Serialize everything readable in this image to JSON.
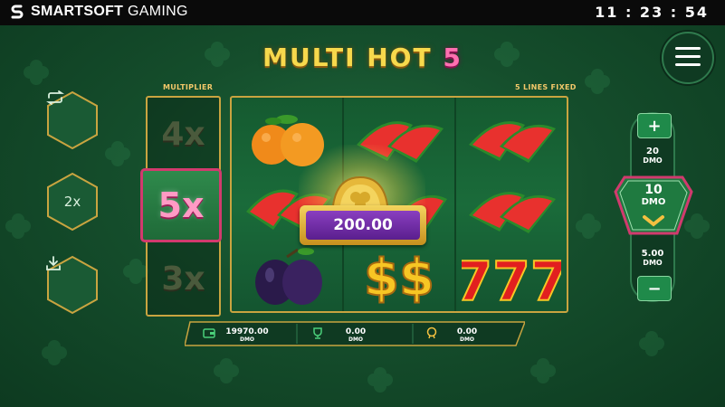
{
  "header": {
    "brand_bold": "SMARTSOFT",
    "brand_light": "GAMING",
    "clock": "11 : 23 : 54"
  },
  "game": {
    "title_main": "MULTI HOT",
    "title_num": "5",
    "multiplier_label": "MULTIPLIER",
    "lines_label": "5 LINES FIXED",
    "multipliers": [
      "4x",
      "5x",
      "3x"
    ],
    "active_multiplier": "5x",
    "reels": [
      [
        "orange",
        "watermelon",
        "plum"
      ],
      [
        "watermelon",
        "coin",
        "dollar"
      ],
      [
        "watermelon",
        "watermelon",
        "seven"
      ]
    ],
    "win_amount": "200.00"
  },
  "left_controls": {
    "autoplay_icon": "repeat-icon",
    "speed_label": "2x",
    "history_icon": "download-icon"
  },
  "bet": {
    "plus": "+",
    "minus": "−",
    "above": {
      "value": "20",
      "currency": "DMO"
    },
    "selected": {
      "value": "10",
      "currency": "DMO"
    },
    "below": {
      "value": "5.00",
      "currency": "DMO"
    }
  },
  "info": {
    "balance": {
      "value": "19970.00",
      "currency": "DMO",
      "icon": "wallet-icon"
    },
    "win": {
      "value": "0.00",
      "currency": "DMO",
      "icon": "trophy-icon"
    },
    "bonus": {
      "value": "0.00",
      "currency": "DMO",
      "icon": "medal-icon"
    }
  },
  "colors": {
    "gold": "#f7d94c",
    "pink": "#ff6fb0",
    "purple": "#6a2aa0",
    "green": "#1f8a4a"
  }
}
